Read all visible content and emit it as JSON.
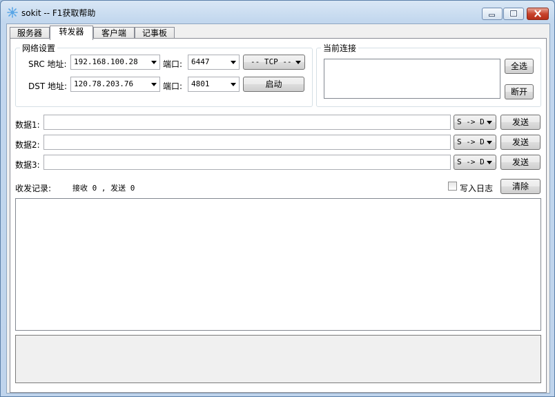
{
  "window": {
    "title": "sokit -- F1获取帮助"
  },
  "tabs": [
    {
      "label": "服务器",
      "active": false
    },
    {
      "label": "转发器",
      "active": true
    },
    {
      "label": "客户端",
      "active": false
    },
    {
      "label": "记事板",
      "active": false
    }
  ],
  "network": {
    "title": "网络设置",
    "src_label": "SRC 地址:",
    "src_address": "192.168.100.28",
    "src_port_label": "端口:",
    "src_port": "6447",
    "protocol": "-- TCP --",
    "dst_label": "DST 地址:",
    "dst_address": "120.78.203.76",
    "dst_port_label": "端口:",
    "dst_port": "4801",
    "start_label": "启动"
  },
  "connections": {
    "title": "当前连接",
    "select_all_label": "全选",
    "disconnect_label": "断开"
  },
  "data_rows": [
    {
      "label": "数据1:",
      "value": "",
      "direction": "S -> D",
      "send_label": "发送"
    },
    {
      "label": "数据2:",
      "value": "",
      "direction": "S -> D",
      "send_label": "发送"
    },
    {
      "label": "数据3:",
      "value": "",
      "direction": "S -> D",
      "send_label": "发送"
    }
  ],
  "log": {
    "title": "收发记录:",
    "stats": "接收 0 , 发送 0",
    "write_log_label": "写入日志",
    "write_log_checked": false,
    "clear_label": "清除"
  }
}
